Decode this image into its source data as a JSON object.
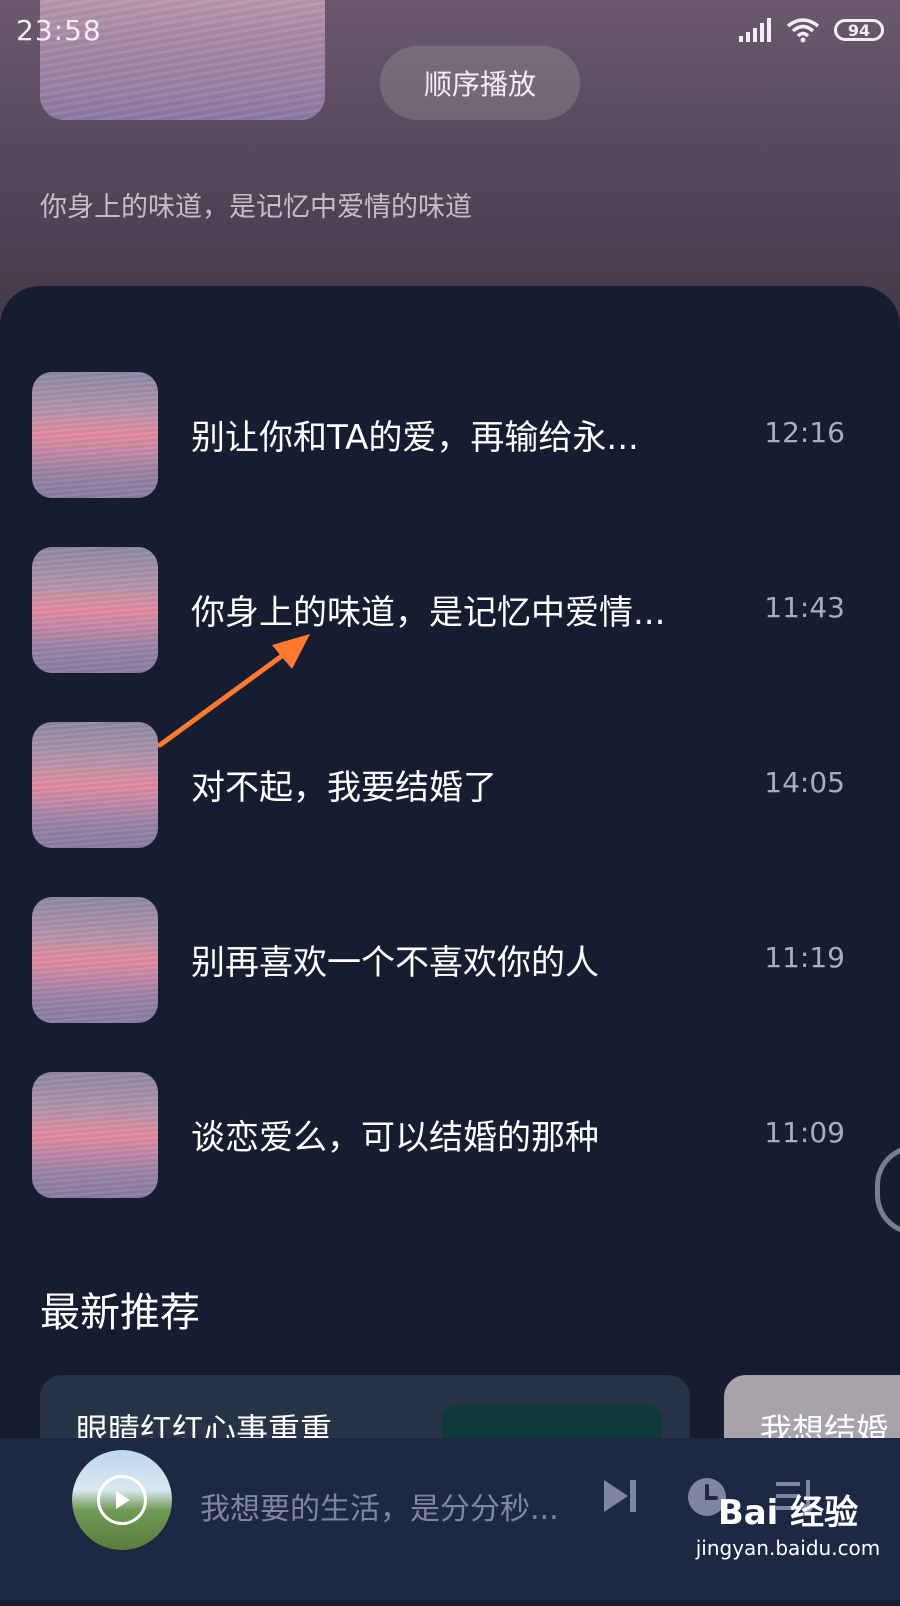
{
  "status_bar": {
    "time": "23:58",
    "battery": "94"
  },
  "header": {
    "play_mode_button": "顺序播放",
    "subtitle": "你身上的味道，是记忆中爱情的味道"
  },
  "list": {
    "items": [
      {
        "title": "别让你和TA的爱，再输给永...",
        "time": "12:16"
      },
      {
        "title": "你身上的味道，是记忆中爱情...",
        "time": "11:43"
      },
      {
        "title": "对不起，我要结婚了",
        "time": "14:05"
      },
      {
        "title": "别再喜欢一个不喜欢你的人",
        "time": "11:19"
      },
      {
        "title": "谈恋爱么，可以结婚的那种",
        "time": "11:09"
      }
    ]
  },
  "recommend": {
    "title": "最新推荐",
    "cards": [
      {
        "title": "眼睛红红心事重重"
      },
      {
        "title": "我想结婚"
      }
    ]
  },
  "player": {
    "now_playing": "我想要的生活，是分分秒..."
  },
  "watermark": {
    "logo": "Bai 经验",
    "url": "jingyan.baidu.com"
  },
  "colors": {
    "sheet": "#161d31",
    "arrow": "#ff7a2e",
    "player_bar": "#1e2744"
  }
}
